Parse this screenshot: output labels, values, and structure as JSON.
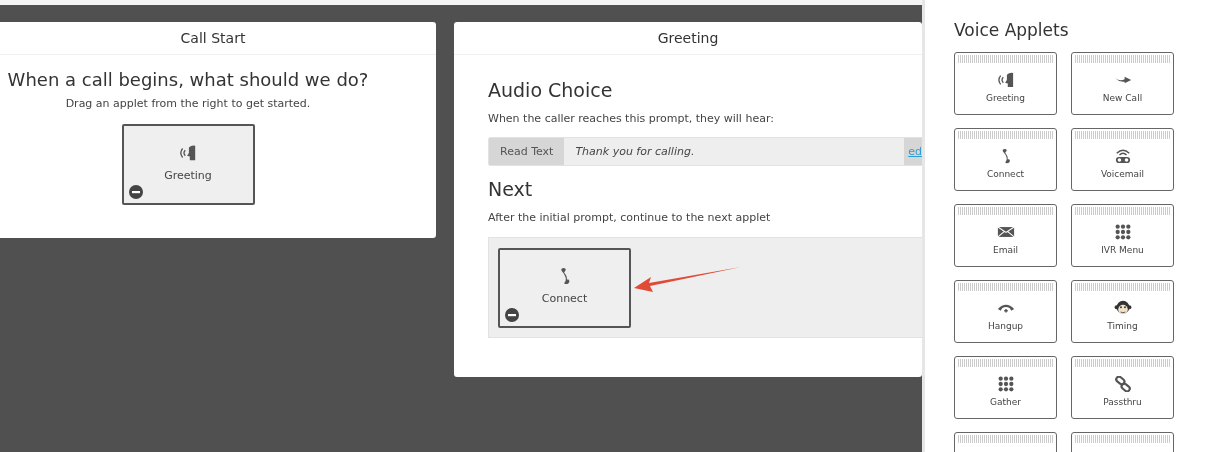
{
  "flow": [
    {
      "title": "Call Start",
      "heading": "When a call begins, what should we do?",
      "hint": "Drag an applet from the right to get started.",
      "applet": {
        "kind": "greeting",
        "label": "Greeting"
      }
    },
    {
      "title": "Greeting",
      "sections": [
        {
          "kind": "prompt",
          "heading": "Audio Choice",
          "hint": "When the caller reaches this prompt, they will hear:",
          "mode": "Read Text",
          "value": "Thank you for calling.",
          "link": "ed"
        },
        {
          "kind": "next",
          "heading": "Next",
          "hint": "After the initial prompt, continue to the next applet",
          "applet": {
            "kind": "connect",
            "label": "Connect"
          }
        }
      ]
    }
  ],
  "sidebar": {
    "title": "Voice Applets",
    "applets": [
      {
        "kind": "greeting",
        "label": "Greeting"
      },
      {
        "kind": "newcall",
        "label": "New Call"
      },
      {
        "kind": "connect",
        "label": "Connect"
      },
      {
        "kind": "voicemail",
        "label": "Voicemail"
      },
      {
        "kind": "email",
        "label": "Email"
      },
      {
        "kind": "keypad",
        "label": "IVR Menu"
      },
      {
        "kind": "hangup",
        "label": "Hangup"
      },
      {
        "kind": "monkey",
        "label": "Timing"
      },
      {
        "kind": "keypad",
        "label": "Gather"
      },
      {
        "kind": "link",
        "label": "Passthru"
      }
    ]
  }
}
